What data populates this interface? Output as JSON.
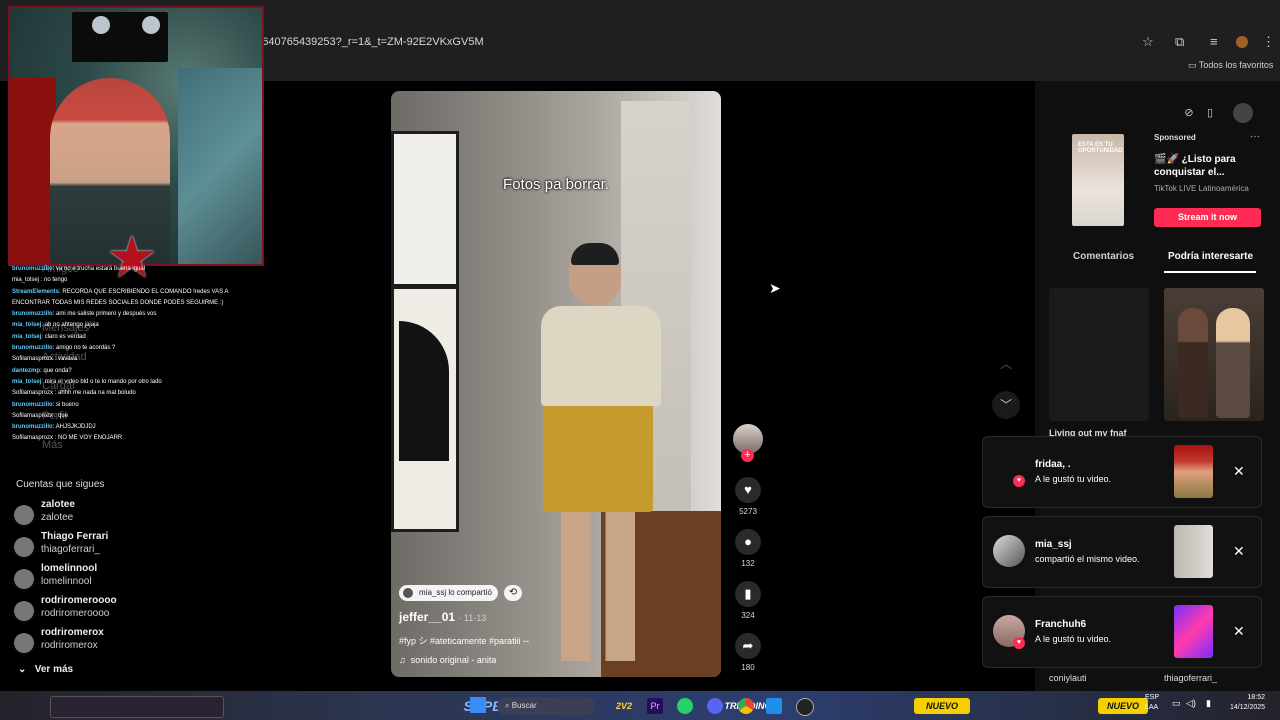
{
  "browser": {
    "url": "74640765439253?_r=1&_t=ZM-92E2VKxGV5M",
    "bookmarks_label": "Todos los favoritos",
    "icons": [
      "star-icon",
      "extensions-icon",
      "queue-icon",
      "profile-icon",
      "kebab-menu-icon"
    ]
  },
  "chat": {
    "messages": [
      {
        "user": "brunomuzzillo",
        "text": ": va no e trucha estará buena igual"
      },
      {
        "user": "",
        "text": "mia_tolsej : no tengo"
      },
      {
        "user": "StreamElements",
        "text": ": RECORDA QUE ESCRIBIENDO EL COMANDO !redes VAS A"
      },
      {
        "user": "",
        "text": "ENCONTRAR TODAS MIS REDES SOCIALES DONDE PODES SEGUIRME :)"
      },
      {
        "user": "brunomuzzillo",
        "text": ": ami me saliste primero y después vos"
      },
      {
        "user": "mia_tolsej",
        "text": ": ah no ahtengo jajaja"
      },
      {
        "user": "mia_tolsej",
        "text": ": claro es verdad"
      },
      {
        "user": "brunomuzzillo",
        "text": ": amigo no te acordás ?"
      },
      {
        "user": "",
        "text": "Sofilamasprozx : vavava"
      },
      {
        "user": "dantezmp",
        "text": ": que onda?"
      },
      {
        "user": "mia_tolsej",
        "text": ": mira el video bld o te lo mando por otro lado"
      },
      {
        "user": "",
        "text": "Sofilamasprozx : ahhh me nada na mal boludo"
      },
      {
        "user": "brunomuzzillo",
        "text": ": si bueno"
      },
      {
        "user": "",
        "text": "Sofilamasprozx : que"
      },
      {
        "user": "brunomuzzillo",
        "text": ": AHJSJKJDJDJ"
      },
      {
        "user": "",
        "text": "Sofilamasprozx : NO ME VOY ENOJARR"
      }
    ]
  },
  "sidebar": {
    "faded_items": [
      "Amigos",
      "Mensajes",
      "Actividad",
      "Cargar",
      "Perfil",
      "Más"
    ],
    "following_title": "Cuentas que sigues",
    "accounts": [
      {
        "name": "zalotee",
        "handle": "zalotee"
      },
      {
        "name": "Thiago Ferrari",
        "handle": "thiagoferrari_"
      },
      {
        "name": "lomelinnool",
        "handle": "lomelinnool"
      },
      {
        "name": "rodriromeroooo",
        "handle": "rodriromeroooo"
      },
      {
        "name": "rodriromerox",
        "handle": "rodriromerox"
      }
    ],
    "see_more": "Ver más"
  },
  "video": {
    "overlay_title": "Fotos pa borrar.",
    "shared_by": "mia_ssj lo compartió",
    "author": "jeffer__01",
    "date": "· 11-13",
    "caption": "#fyp シ #ateticamente #paratiii --",
    "sound": "sonido original - anita",
    "likes": "5273",
    "comments": "132",
    "saves": "324",
    "shares": "180"
  },
  "ad": {
    "sponsored": "Sponsored",
    "thumb_text": "ESTA ES TU OPORTUNIDAD",
    "title": "🎬🚀 ¿Listo para conquistar el...",
    "subtitle": "TikTok LIVE Latinoamérica",
    "cta": "Stream it now"
  },
  "tabs": {
    "comments": "Comentarios",
    "interest": "Podría interesarte"
  },
  "suggestions": {
    "caption": "Living out my fnaf",
    "bottom_left": "coniylauti",
    "bottom_right": "thiagoferrari_"
  },
  "notifications": [
    {
      "name": "fridaa, .",
      "action": "A le gustó tu video."
    },
    {
      "name": "mia_ssj",
      "action": "compartió el mismo video."
    },
    {
      "name": "Franchuh6",
      "action": "A le gustó tu video."
    }
  ],
  "taskbar": {
    "search": "Buscar",
    "lang": "ESP\nLAA",
    "time": "18:52",
    "date": "14/12/2025",
    "games": [
      "SUPER 1V1",
      "2V2",
      "TRENDING",
      "NUEVO",
      "NUEVO"
    ]
  },
  "colors": {
    "accent": "#fe2c55",
    "chat_user": "#5ecfff"
  }
}
